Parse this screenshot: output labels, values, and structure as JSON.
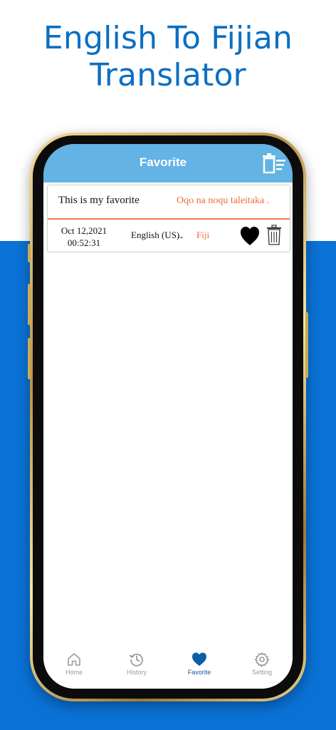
{
  "promo": {
    "title_line1": "English To Fijian",
    "title_line2": "Translator"
  },
  "app": {
    "title": "Favorite",
    "header_color": "#63b3e4",
    "accent_color": "#ef6a3a"
  },
  "favorites": [
    {
      "source_text": "This is my favorite",
      "translated_text": "Oqo na noqu taleitaka .",
      "date": "Oct 12,2021",
      "time": "00:52:31",
      "from_language": "English (US)",
      "arrow": "→",
      "to_language": "Fiji"
    }
  ],
  "tabs": [
    {
      "label": "Home",
      "icon": "home-icon",
      "active": false
    },
    {
      "label": "History",
      "icon": "history-icon",
      "active": false
    },
    {
      "label": "Favorite",
      "icon": "heart-icon",
      "active": true
    },
    {
      "label": "Setting",
      "icon": "gear-icon",
      "active": false
    }
  ]
}
